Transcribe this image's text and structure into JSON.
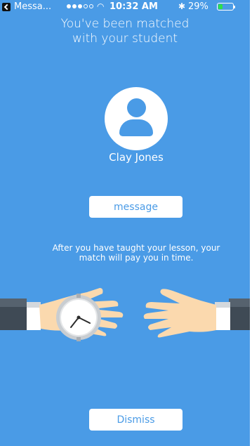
{
  "status_bar": {
    "carrier": "Messa...",
    "time": "10:32 AM",
    "battery": "29%",
    "battery_level": 0.29
  },
  "match": {
    "title": "You've been matched with your student",
    "student_name": "Clay Jones",
    "message_button": "message",
    "info_text": "After you have taught your lesson, your match will pay you in time.",
    "dismiss_button": "Dismiss"
  },
  "colors": {
    "background": "#4a9be6",
    "button_text": "#4a9be6",
    "battery_fill": "#2ee04a"
  }
}
